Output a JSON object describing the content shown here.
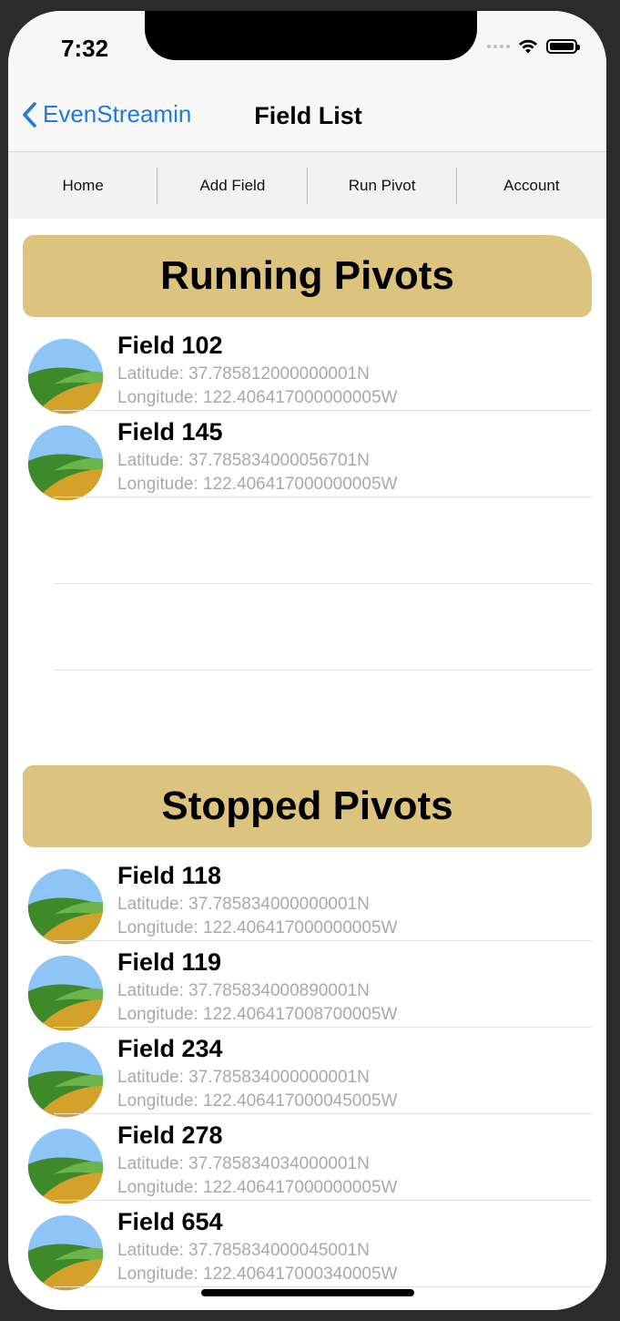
{
  "status": {
    "time": "7:32"
  },
  "nav": {
    "back_label": "EvenStreamin",
    "title": "Field List"
  },
  "tabs": [
    "Home",
    "Add Field",
    "Run Pivot",
    "Account"
  ],
  "running": {
    "header": "Running Pivots",
    "items": [
      {
        "name": "Field 102",
        "lat": "Latitude: 37.785812000000001N",
        "lon": "Longitude: 122.406417000000005W"
      },
      {
        "name": "Field 145",
        "lat": "Latitude: 37.785834000056701N",
        "lon": "Longitude: 122.406417000000005W"
      }
    ]
  },
  "stopped": {
    "header": "Stopped Pivots",
    "items": [
      {
        "name": "Field 118",
        "lat": "Latitude: 37.785834000000001N",
        "lon": "Longitude: 122.406417000000005W"
      },
      {
        "name": "Field 119",
        "lat": "Latitude: 37.785834000890001N",
        "lon": "Longitude: 122.406417008700005W"
      },
      {
        "name": "Field 234",
        "lat": "Latitude: 37.785834000000001N",
        "lon": "Longitude: 122.406417000045005W"
      },
      {
        "name": "Field 278",
        "lat": "Latitude: 37.785834034000001N",
        "lon": "Longitude: 122.406417000000005W"
      },
      {
        "name": "Field 654",
        "lat": "Latitude: 37.785834000045001N",
        "lon": "Longitude: 122.406417000340005W"
      }
    ]
  },
  "icons": {
    "field": "field-landscape-icon",
    "back": "chevron-left-icon",
    "wifi": "wifi-icon",
    "battery": "battery-icon"
  },
  "colors": {
    "accent": "#1f7ae0",
    "section_bg": "#dcc47f",
    "secondary_text": "#a9a9a9"
  }
}
